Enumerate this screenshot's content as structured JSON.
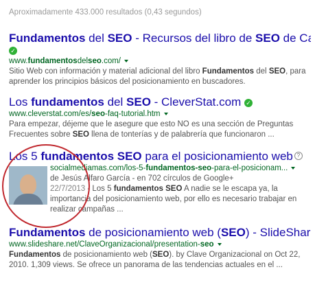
{
  "stats": "Aproximadamente 433.000 resultados (0,43 segundos)",
  "results": [
    {
      "title_parts": [
        {
          "t": "Fundamentos",
          "b": true
        },
        {
          "t": " del ",
          "b": false
        },
        {
          "t": "SEO",
          "b": true
        },
        {
          "t": " - Recursos del libro de ",
          "b": false
        },
        {
          "t": "SEO",
          "b": true
        },
        {
          "t": " de Carlo",
          "b": false
        }
      ],
      "url_parts": [
        {
          "t": "www.",
          "b": false
        },
        {
          "t": "fundamentos",
          "b": true
        },
        {
          "t": "del",
          "b": false
        },
        {
          "t": "seo",
          "b": true
        },
        {
          "t": ".com/",
          "b": false
        }
      ],
      "snippet_html_parts": [
        {
          "t": "Sitio Web con información y material adicional del libro ",
          "b": false
        },
        {
          "t": "Fundamentos",
          "b": true
        },
        {
          "t": " del ",
          "b": false
        },
        {
          "t": "SEO",
          "b": true
        },
        {
          "t": ", para aprender los principios básicos del posicionamiento en buscadores.",
          "b": false
        }
      ]
    },
    {
      "title_parts": [
        {
          "t": "Los ",
          "b": false
        },
        {
          "t": "fundamentos",
          "b": true
        },
        {
          "t": " del ",
          "b": false
        },
        {
          "t": "SEO",
          "b": true
        },
        {
          "t": " - CleverStat.com",
          "b": false
        }
      ],
      "url_parts": [
        {
          "t": "www.cleverstat.com/es/",
          "b": false
        },
        {
          "t": "seo",
          "b": true
        },
        {
          "t": "-faq-tutorial.htm",
          "b": false
        }
      ],
      "snippet_html_parts": [
        {
          "t": "Para empezar, déjeme que le asegure que esto NO es una sección de Preguntas Frecuentes sobre ",
          "b": false
        },
        {
          "t": "SEO",
          "b": true
        },
        {
          "t": " llena de tonterías y de palabrería que funcionaron ...",
          "b": false
        }
      ]
    },
    {
      "title_parts": [
        {
          "t": "Los 5 ",
          "b": false
        },
        {
          "t": "fundamentos SEO",
          "b": true
        },
        {
          "t": " para el posicionamiento web",
          "b": false
        }
      ],
      "url_parts": [
        {
          "t": "socialmediamas.com/los-5-",
          "b": false
        },
        {
          "t": "fundamentos-seo",
          "b": true
        },
        {
          "t": "-para-el-posicionam...",
          "b": false
        }
      ],
      "byline": "de Jesús Alfaro García - en 702 círculos de Google+",
      "date": "22/7/2013",
      "snippet_html_parts": [
        {
          "t": " - Los 5 ",
          "b": false
        },
        {
          "t": "fundamentos SEO",
          "b": true
        },
        {
          "t": " A nadie se le escapa ya, la importancia del posicionamiento web, por ello es necesario trabajar en realizar campañas ...",
          "b": false
        }
      ]
    },
    {
      "title_parts": [
        {
          "t": "Fundamentos",
          "b": true
        },
        {
          "t": " de posicionamiento web (",
          "b": false
        },
        {
          "t": "SEO",
          "b": true
        },
        {
          "t": ") - SlideShare",
          "b": false
        }
      ],
      "url_parts": [
        {
          "t": "www.slideshare.net/ClaveOrganizacional/presentation-",
          "b": false
        },
        {
          "t": "seo",
          "b": true
        }
      ],
      "snippet_html_parts": [
        {
          "t": "Fundamentos",
          "b": true
        },
        {
          "t": " de posicionamiento web (",
          "b": false
        },
        {
          "t": "SEO",
          "b": true
        },
        {
          "t": "). by Clave Organizacional on Oct 22, 2010. 1,309 views. Se ofrece un panorama de las tendencias actuales en el ...",
          "b": false
        }
      ]
    }
  ],
  "icons": {
    "verified": "verified-check-icon",
    "help": "help-icon",
    "dropdown": "chevron-down-icon"
  },
  "colors": {
    "title": "#1a0dab",
    "url": "#006621",
    "snippet": "#545454",
    "verified": "#2fb136",
    "highlight_circle": "#c0282e"
  }
}
